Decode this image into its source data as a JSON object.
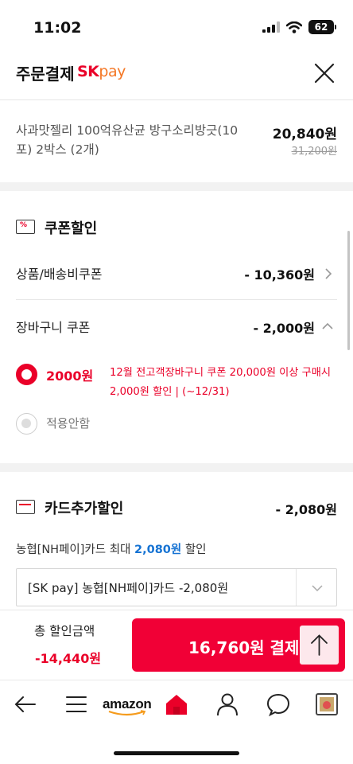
{
  "status_bar": {
    "time": "11:02",
    "battery": "62"
  },
  "header": {
    "title": "주문결제",
    "brand_sk": "SK",
    "brand_pay": "pay"
  },
  "product": {
    "name": "사과맛젤리 100억유산균 방구소리방긋(10포) 2박스 (2개)",
    "price": "20,840원",
    "original_price": "31,200원"
  },
  "coupon_section": {
    "title": "쿠폰할인",
    "icon_text": "%",
    "rows": [
      {
        "label": "상품/배송비쿠폰",
        "value": "- 10,360원"
      },
      {
        "label": "장바구니 쿠폰",
        "value": "- 2,000원"
      }
    ],
    "options": [
      {
        "amount": "2000원",
        "description": "12월 전고객장바구니 쿠폰 20,000원 이상 구매시 2,000원 할인 | (~12/31)",
        "selected": true
      },
      {
        "label": "적용안함",
        "selected": false
      }
    ]
  },
  "card_section": {
    "title": "카드추가할인",
    "value": "- 2,080원",
    "note_prefix": "농협[NH페이]카드 최대 ",
    "note_amount": "2,080원",
    "note_suffix": " 할인",
    "select_value": "[SK pay] 농협[NH페이]카드 -2,080원"
  },
  "bottom_bar": {
    "total_label": "총 할인금액",
    "total_amount": "-14,440원",
    "pay_label": "16,760원 결제"
  },
  "nav": {
    "amazon_label": "amazon",
    "icons": [
      "back-arrow-icon",
      "menu-icon",
      "amazon-logo",
      "home-icon",
      "profile-icon",
      "chat-icon",
      "recent-icon"
    ]
  },
  "colors": {
    "accent": "#ea0029",
    "pay_button": "#f10036",
    "link_blue": "#1673d3",
    "sk_orange": "#f47725"
  }
}
